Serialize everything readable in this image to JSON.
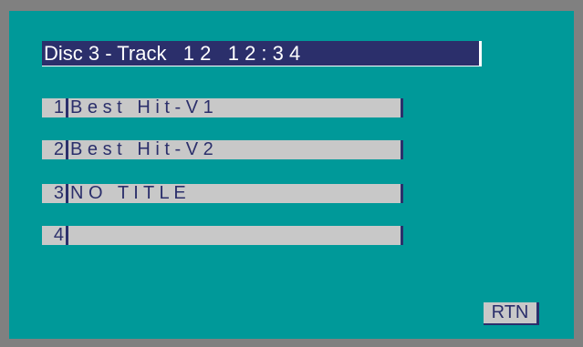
{
  "header": {
    "disc_track_time": "Disc 3 - Track   1 2   1 2 : 3 4"
  },
  "tracks": [
    {
      "number": "1",
      "title": "B e s t   H i t - V 1"
    },
    {
      "number": "2",
      "title": "B e s t   H i t - V 2"
    },
    {
      "number": "3",
      "title": "N O   T I T L E"
    },
    {
      "number": "4",
      "title": ""
    }
  ],
  "return_button": {
    "label": "RTN"
  },
  "colors": {
    "frame": "#808080",
    "screen": "#009999",
    "header_bg": "#2b2f6b",
    "row_bg": "#c8c8c8",
    "text_dark": "#2b2f6b"
  }
}
